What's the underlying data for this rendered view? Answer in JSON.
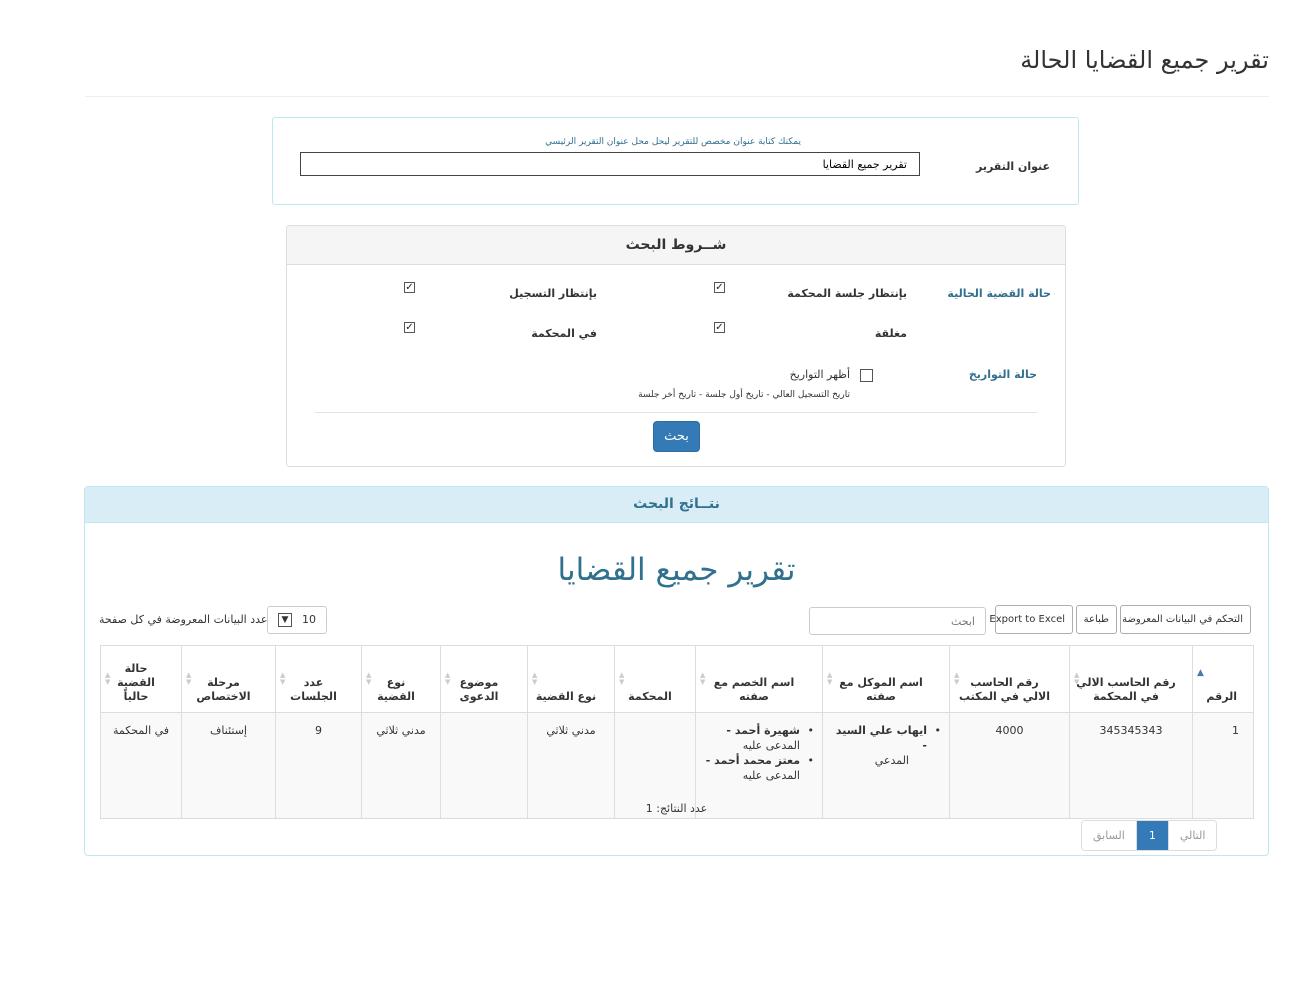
{
  "page": {
    "title": "تقرير جميع القضايا الحالة"
  },
  "report_title": {
    "label": "عنوان التقرير",
    "hint": "يمكنك كتابة عنوان مخصص للتقرير ليحل محل عنوان التقرير الرئيسي",
    "value": "تقرير جميع القضايا"
  },
  "search": {
    "heading": "شــروط البحث",
    "case_status_label": "حالة القضية الحالية",
    "options": [
      {
        "label": "بإنتظار جلسة المحكمة",
        "checked": true
      },
      {
        "label": "بإنتظار التسجيل",
        "checked": true
      },
      {
        "label": "مغلقة",
        "checked": true
      },
      {
        "label": "في المحكمة",
        "checked": true
      }
    ],
    "dates_label": "حالة التواريخ",
    "show_dates_label": "أظهر التواريخ",
    "show_dates_checked": false,
    "dates_hint": "تاريخ التسجيل العالي - تاريخ أول جلسة - تاريخ أخر جلسة",
    "button": "بحث"
  },
  "results": {
    "heading": "نتــائج البحث",
    "report_heading": "تقرير جميع القضايا",
    "buttons": {
      "columns": "التحكم في البيانات المعروضة",
      "print": "طباعة",
      "excel": "Export to Excel"
    },
    "search_placeholder": "ابحث",
    "page_length": "10",
    "page_length_label": "عدد البيانات المعروضة في كل صفحة",
    "columns": [
      "الرقم",
      "رقم الحاسب الالي في المحكمة",
      "رقم الحاسب الالي في المكتب",
      "اسم الموكل مع صفته",
      "اسم الخصم مع صفته",
      "المحكمة",
      "نوع القضية",
      "موضوع الدعوى",
      "نوع القضية",
      "عدد الجلسات",
      "مرحلة الاختصاص",
      "حالة القضية حالياً"
    ],
    "row": {
      "num": "1",
      "court_no": "345345343",
      "office_no": "4000",
      "client": {
        "name": "ايهاب علي السيد",
        "role": "المدعي"
      },
      "opponents": [
        {
          "name": "شهيرة أحمد",
          "role": "المدعى عليه"
        },
        {
          "name": "معتز محمد أحمد",
          "role": "المدعى عليه"
        }
      ],
      "court": "",
      "case_type": "مدني ثلاثي",
      "subject": "",
      "case_type2": "مدني ثلاثي",
      "sessions": "9",
      "stage": "إستئناف",
      "status": "في المحكمة"
    },
    "count_label": "عدد النتائج: 1",
    "pager": {
      "next": "التالي",
      "current": "1",
      "prev": "السابق"
    }
  }
}
